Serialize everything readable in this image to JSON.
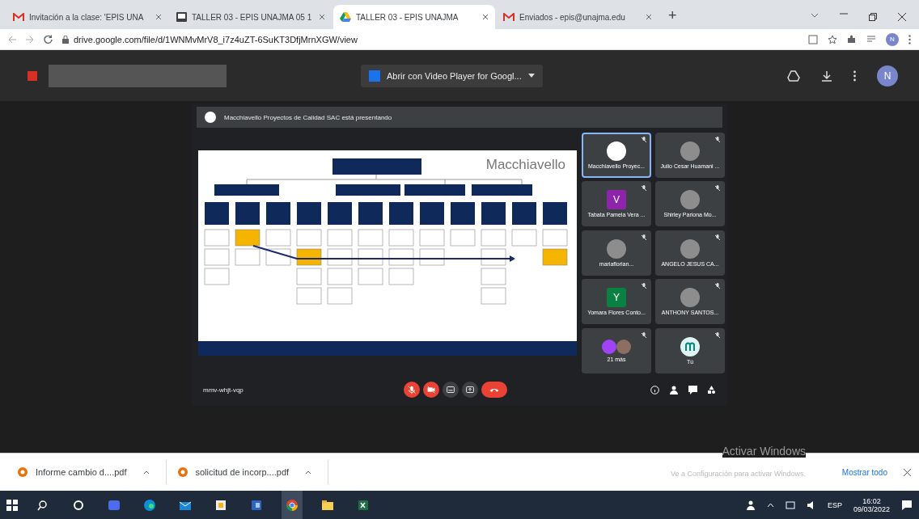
{
  "browser": {
    "tabs": [
      {
        "kind": "gmail",
        "title": "Invitación a la clase: 'EPIS UNA",
        "selected": false
      },
      {
        "kind": "classroom",
        "title": "TALLER 03 - EPIS UNAJMA 05 1",
        "selected": false
      },
      {
        "kind": "drive",
        "title": "TALLER 03 - EPIS UNAJMA",
        "selected": true
      },
      {
        "kind": "gmail",
        "title": "Enviados - epis@unajma.edu",
        "selected": false
      }
    ],
    "profile_letter": "N",
    "new_tab": "+",
    "url": "drive.google.com/file/d/1WNMvMrV8_i7z4uZT-6SuKT3DfjMrnXGW/view"
  },
  "drive_bar": {
    "open_with": "Abrir con Video Player for Googl...",
    "avatar_letter": "N"
  },
  "meet": {
    "presenter_banner": "Macchiavello Proyectos de Calidad SAC está presentando",
    "slide": {
      "logo": "Macchiavello"
    },
    "participants": [
      {
        "name": "Macchiavello Proyec...",
        "kind": "plain",
        "selected": true
      },
      {
        "name": "Julio Cesar Huamani ...",
        "kind": "photo",
        "selected": false
      },
      {
        "name": "Tabata Pamela Vera ...",
        "kind": "letter",
        "letter": "V",
        "color": "#8e24aa",
        "selected": false
      },
      {
        "name": "Shirley Pariona Mo...",
        "kind": "photo",
        "selected": false
      },
      {
        "name": "mariaflorian...",
        "kind": "photo",
        "selected": false
      },
      {
        "name": "ANGELO JESUS CA...",
        "kind": "photo",
        "selected": false
      },
      {
        "name": "Yomara Flores Conto...",
        "kind": "letter",
        "letter": "Y",
        "color": "#0b8043",
        "selected": false
      },
      {
        "name": "ANTHONY SANTOS...",
        "kind": "photo",
        "selected": false
      },
      {
        "name": "21 más",
        "kind": "group",
        "selected": false
      },
      {
        "name": "Tú",
        "kind": "logo",
        "selected": false
      }
    ],
    "meeting_code": "mmv-whjt-vqp",
    "controls": [
      {
        "kind": "mic",
        "on": false
      },
      {
        "kind": "camera",
        "on": false
      },
      {
        "kind": "captions",
        "on": false
      },
      {
        "kind": "present",
        "on": false
      },
      {
        "kind": "hangup",
        "on": false
      }
    ]
  },
  "downloads": {
    "files": [
      {
        "name": "Informe cambio d....pdf"
      },
      {
        "name": "solicitud de incorp....pdf"
      }
    ],
    "show_all": "Mostrar todo"
  },
  "activation_notice": {
    "title": "Activar Windows",
    "text": "Ve a Configuración para activar Windows."
  },
  "taskbar": {
    "apps": [
      {
        "kind": "search",
        "selected": false
      },
      {
        "kind": "cortana",
        "selected": false
      },
      {
        "kind": "meet",
        "selected": false
      },
      {
        "kind": "edge",
        "selected": false
      },
      {
        "kind": "mail",
        "selected": false
      },
      {
        "kind": "store",
        "selected": false
      },
      {
        "kind": "word",
        "selected": false
      },
      {
        "kind": "chrome",
        "selected": true
      },
      {
        "kind": "explorer",
        "selected": false
      },
      {
        "kind": "excel",
        "selected": false
      }
    ],
    "language": "ESP",
    "time": "16:02",
    "date": "09/03/2022"
  }
}
